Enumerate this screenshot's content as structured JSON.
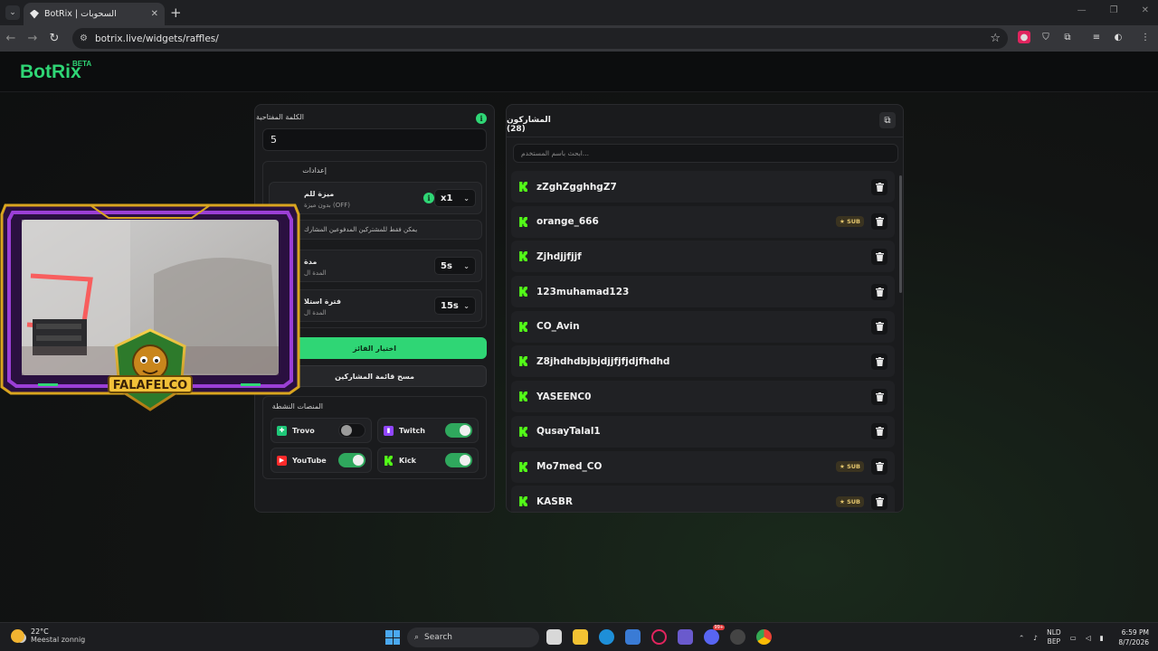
{
  "browser": {
    "tab_title": "BotRix | السحوبات",
    "url": "botrix.live/widgets/raffles/"
  },
  "site": {
    "logo": "BotRix",
    "beta": "BETA"
  },
  "raffle_settings": {
    "keyword_label": "الكلمة المفتاحية",
    "keyword_value": "5",
    "settings_title": "إعدادات",
    "sub_multiplier_label": "ميزة للم",
    "sub_multiplier_sub": "بدون ميزة (OFF)",
    "sub_multiplier_value": "x1",
    "subs_only_note": "يمكن فقط للمشتركين المدفوعين المشارك",
    "duration_label": "مدة",
    "duration_sub": "المدة ال",
    "duration_value": "5s",
    "interval_label": "فترة استلا",
    "interval_sub": "المدة ال",
    "interval_value": "15s",
    "pick_winner_button": "اختيار الفائز",
    "clear_participants_button": "مسح قائمة المشاركين",
    "platforms_title": "المنصات النشطة",
    "platforms": [
      {
        "name": "Trovo",
        "enabled": false,
        "color": "#1ec778"
      },
      {
        "name": "Twitch",
        "enabled": true,
        "color": "#9146ff"
      },
      {
        "name": "YouTube",
        "enabled": true,
        "color": "#ff2a2a"
      },
      {
        "name": "Kick",
        "enabled": true,
        "color": "#53fc18"
      }
    ]
  },
  "participants_panel": {
    "title": "المشاركون (28)",
    "search_placeholder": "ابحث باسم المستخدم...",
    "sub_badge": "SUB",
    "participants": [
      {
        "username": "zZghZgghhgZ7",
        "sub": false
      },
      {
        "username": "orange_666",
        "sub": true
      },
      {
        "username": "Zjhdjjfjjf",
        "sub": false
      },
      {
        "username": "123muhamad123",
        "sub": false
      },
      {
        "username": "CO_Avin",
        "sub": false
      },
      {
        "username": "Z8jhdhdbjbjdjjfjfjdjfhdhd",
        "sub": false
      },
      {
        "username": "YASEENC0",
        "sub": false
      },
      {
        "username": "QusayTalal1",
        "sub": false
      },
      {
        "username": "Mo7med_CO",
        "sub": true
      },
      {
        "username": "KASBR",
        "sub": true
      }
    ]
  },
  "overlay": {
    "channel_name": "FALAFELCO"
  },
  "taskbar": {
    "temperature": "22°C",
    "weather": "Meestal zonnig",
    "search": "Search",
    "lang_top": "NLD",
    "lang_bottom": "BEP",
    "time": "6:59 PM",
    "date": "8/7/2026",
    "notification_count": "99+"
  },
  "colors": {
    "accent": "#2fd675",
    "kick": "#53fc18",
    "sub_badge": "#e6c86e",
    "frame_purple": "#9b3fd6",
    "frame_gold": "#d9a51f"
  }
}
